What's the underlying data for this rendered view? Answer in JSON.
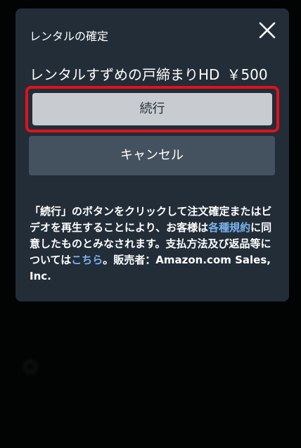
{
  "modal": {
    "header": "レンタルの確定",
    "title": "レンタルすずめの戸締まりHD",
    "price": "￥500",
    "continue_label": "続行",
    "cancel_label": "キャンセル",
    "terms": {
      "part1": "「続行」のボタンをクリックして注文確定またはビデオを再生することにより、お客様は",
      "terms_link": "各種規約",
      "part2": "に同意したものとみなされます。支払方法及び返品等については",
      "here_link": "こちら",
      "part3": "。販売者：Amazon.com Sales, Inc."
    }
  },
  "icons": {
    "close": "close-icon"
  },
  "colors": {
    "modal_bg": "#222d38",
    "continue_bg": "#c8cbcf",
    "cancel_bg": "#44525f",
    "highlight_border": "#e3101a",
    "link": "#7ab4ef"
  }
}
